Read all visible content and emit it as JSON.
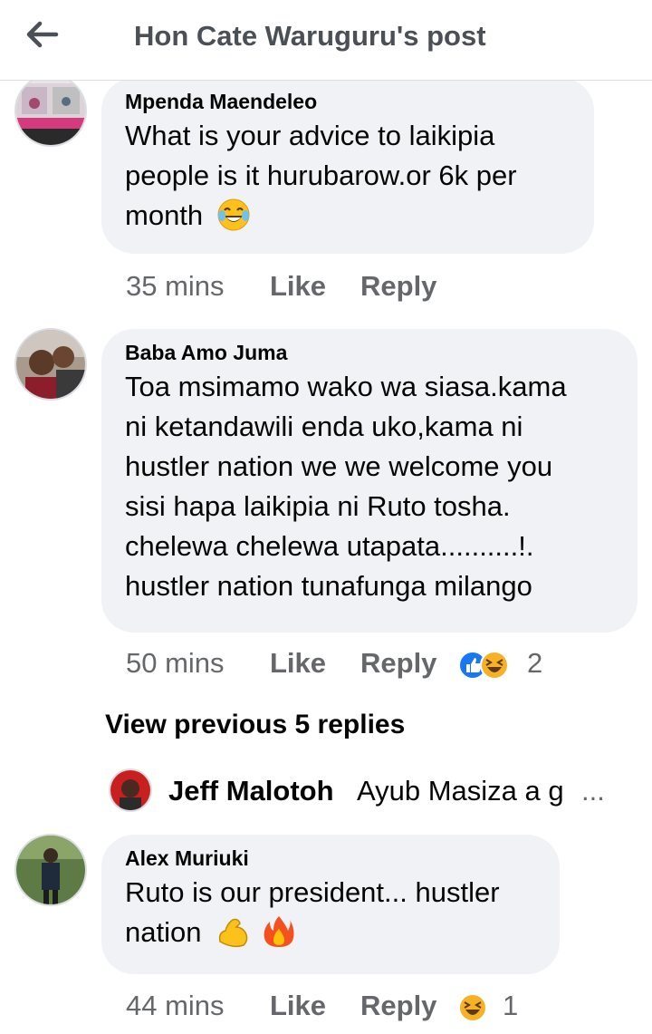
{
  "header": {
    "title": "Hon Cate Waruguru's post",
    "back_icon": "arrow-left-icon"
  },
  "comments": [
    {
      "author": "Mpenda Maendeleo",
      "lines": [
        "What is your advice to laikipia",
        "people   is it hurubarow.or 6k per",
        "month"
      ],
      "time": "35 mins",
      "like_label": "Like",
      "reply_label": "Reply",
      "emoji": [
        "face-with-tears-of-joy"
      ]
    },
    {
      "author": "Baba Amo Juma",
      "lines": [
        "Toa msimamo wako wa siasa.kama",
        "ni ketandawili enda uko,kama ni",
        "hustler nation we we welcome you",
        "sisi hapa laikipia ni Ruto tosha.",
        "chelewa chelewa utapata..........!.",
        "hustler nation tunafunga milango"
      ],
      "time": "50 mins",
      "like_label": "Like",
      "reply_label": "Reply",
      "reactions": [
        "like",
        "haha"
      ],
      "reaction_count": "2"
    },
    {
      "author": "Alex Muriuki",
      "lines": [
        "Ruto is our president... hustler",
        "nation"
      ],
      "time": "44 mins",
      "like_label": "Like",
      "reply_label": "Reply",
      "emoji": [
        "flexed-biceps",
        "fire"
      ],
      "reactions": [
        "haha"
      ],
      "reaction_count": "1"
    }
  ],
  "view_previous": "View previous 5 replies",
  "reply_preview": {
    "name": "Jeff Malotoh",
    "text": "Ayub Masiza a g",
    "ellipsis": "..."
  },
  "colors": {
    "bubble": "#f0f2f5",
    "meta": "#65676b",
    "like_blue": "#1877f2",
    "haha_yellow": "#f7b125"
  }
}
